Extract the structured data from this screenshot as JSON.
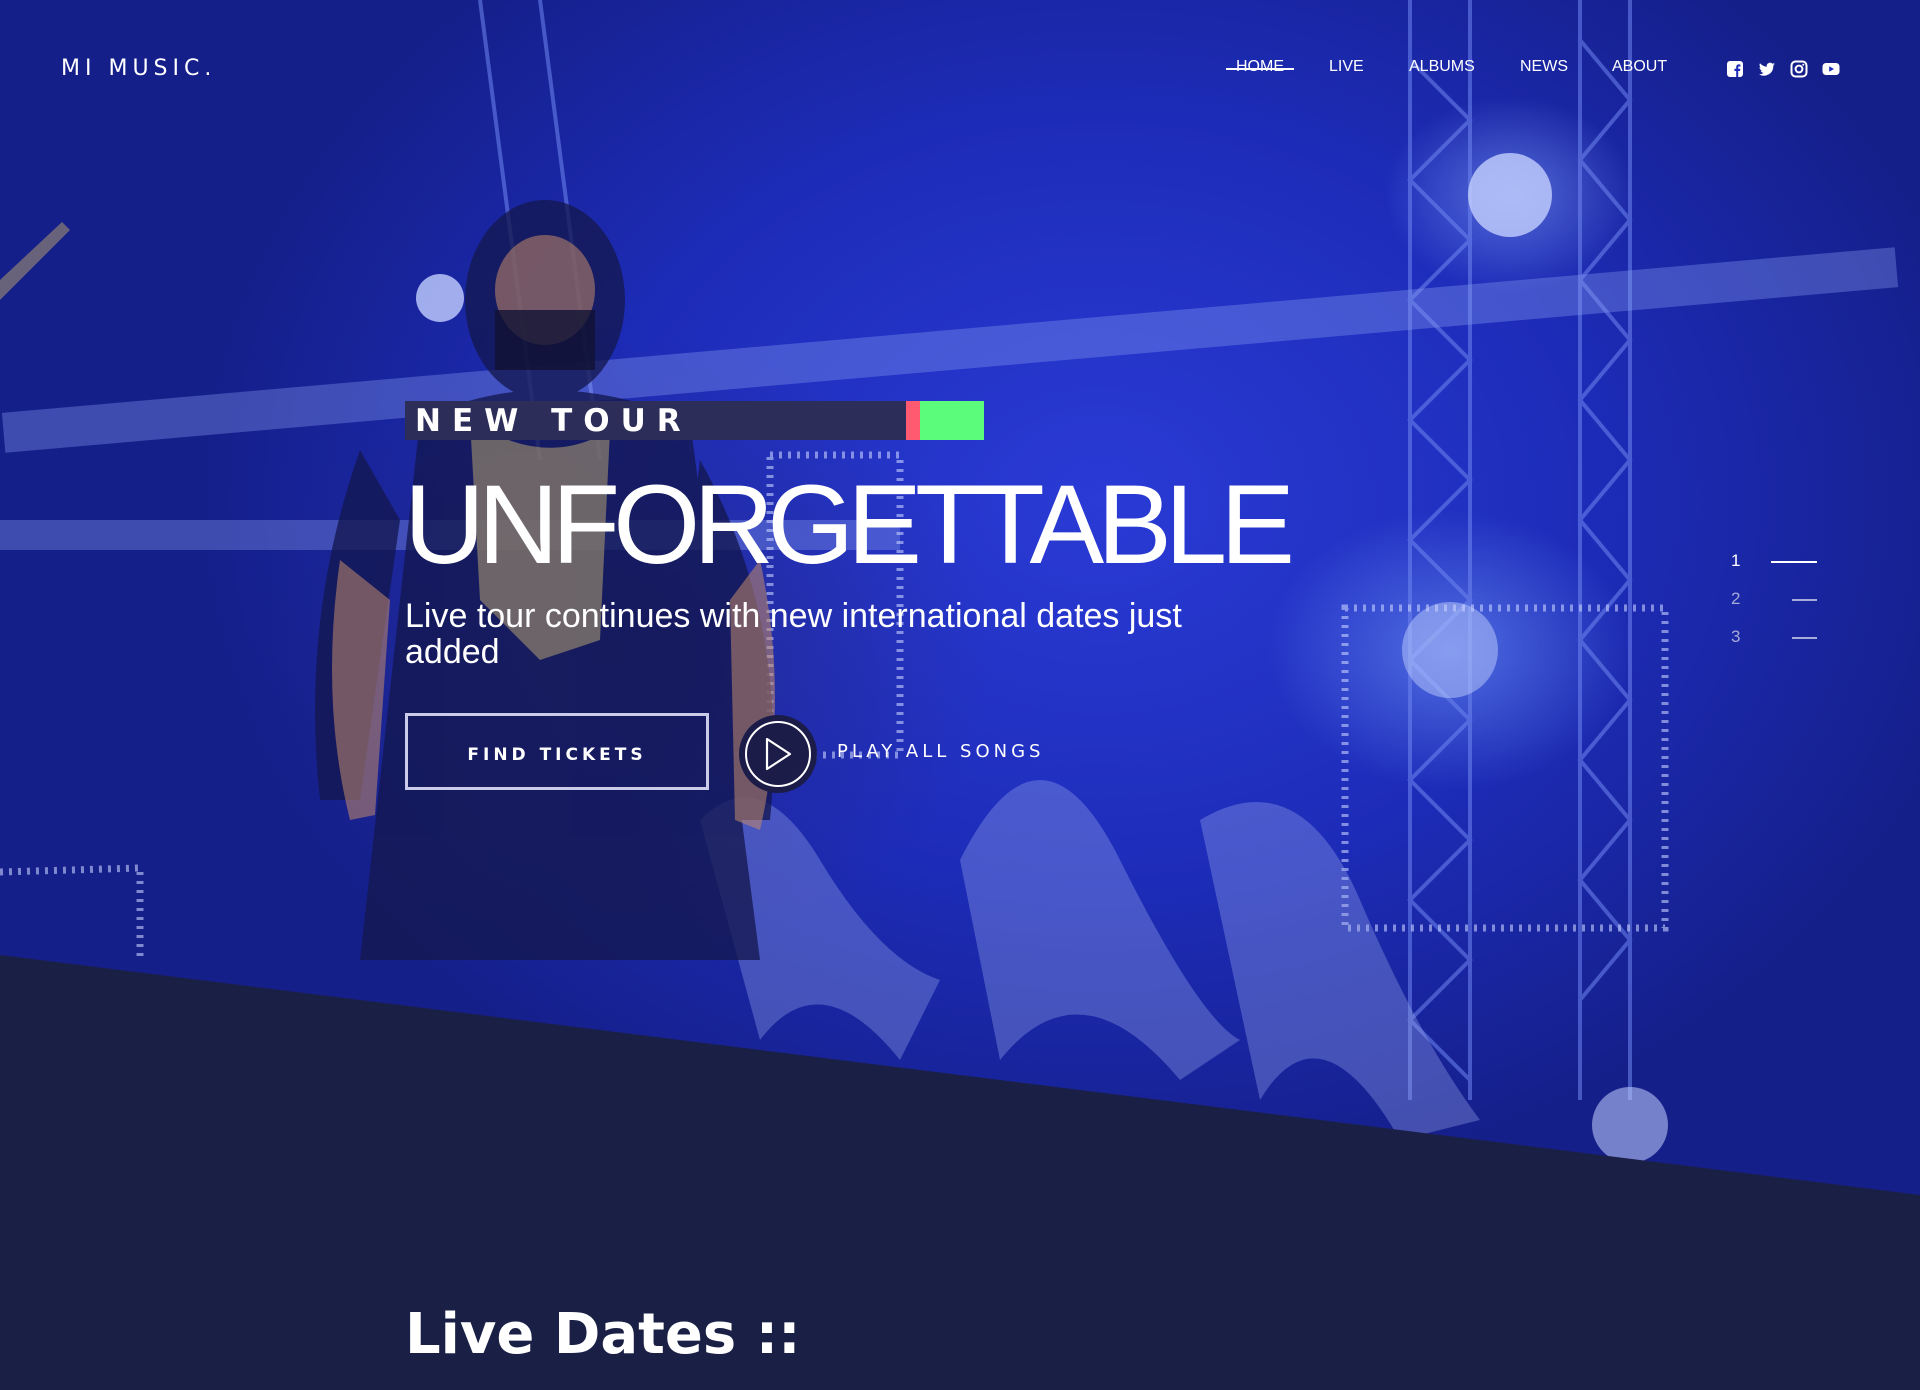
{
  "header": {
    "logo": "MI MUSIC.",
    "nav": [
      "HOME",
      "LIVE",
      "ALBUMS",
      "NEWS",
      "ABOUT"
    ],
    "social_icons": [
      "facebook-icon",
      "twitter-icon",
      "instagram-icon",
      "youtube-icon"
    ]
  },
  "hero": {
    "tag": "NEW TOUR",
    "headline": "UNFORGETTABLE",
    "subtitle": "Live tour continues with new international dates just added",
    "find_tickets_label": "FIND TICKETS",
    "play_label": "PLAY ALL SONGS",
    "slides": [
      "1",
      "2",
      "3"
    ],
    "active_slide": 1
  },
  "section": {
    "title": "Live Dates ::"
  },
  "colors": {
    "hero_blue": "#2a3bd6",
    "navy": "#1a1f45",
    "tag_bg": "#2c2d58",
    "accent_red": "#ff5a70",
    "accent_green": "#5bfb7c"
  }
}
